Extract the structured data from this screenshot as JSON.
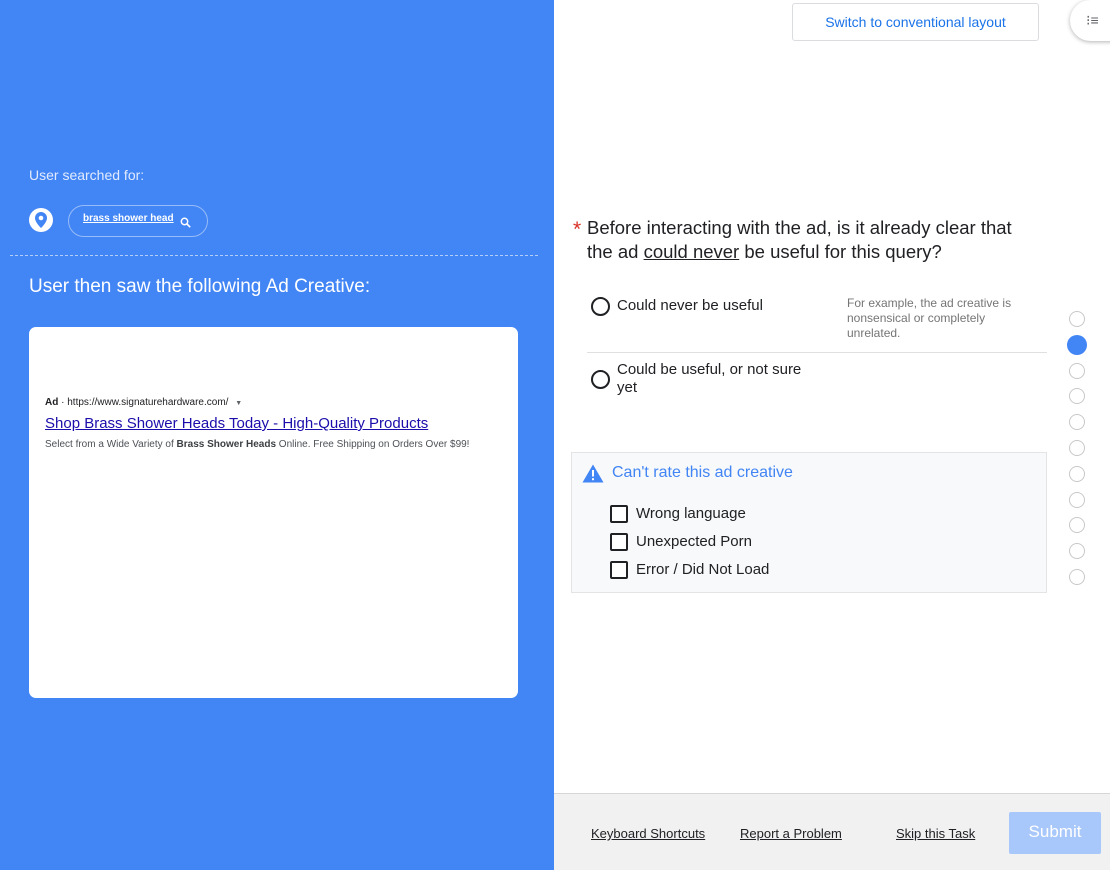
{
  "context": {
    "searched_label": "User searched for:",
    "query": "brass shower head",
    "saw_label": "User then saw the following Ad Creative:"
  },
  "ad": {
    "badge": "Ad",
    "separator": "·",
    "url": "https://www.signaturehardware.com/",
    "headline": "Shop Brass Shower Heads Today - High-Quality Products",
    "desc_before": "Select from a Wide Variety of ",
    "desc_bold": "Brass Shower Heads",
    "desc_after": " Online. Free Shipping on Orders Over $99!"
  },
  "header": {
    "switch_layout": "Switch to conventional layout",
    "menu_glyph": "⁝≡"
  },
  "question": {
    "required_mark": "*",
    "text_before": "Before interacting with the ad, is it already clear that the ad ",
    "text_underlined": "could never",
    "text_after": " be useful for this query?",
    "options": [
      {
        "label": "Could never be useful",
        "help": "For example, the ad creative is nonsensical or completely unrelated."
      },
      {
        "label": "Could be useful, or not sure yet"
      }
    ]
  },
  "cant_rate": {
    "title": "Can't rate this ad creative",
    "options": [
      "Wrong language",
      "Unexpected Porn",
      "Error / Did Not Load"
    ]
  },
  "progress": {
    "total_steps": 11,
    "current_step": 2
  },
  "footer": {
    "keyboard_shortcuts": "Keyboard Shortcuts",
    "report_problem": "Report a Problem",
    "skip_task": "Skip this Task",
    "submit": "Submit"
  },
  "colors": {
    "accent": "#4285f4",
    "required": "#d93025",
    "link": "#1a0dab",
    "submit_disabled": "#a8c7fa"
  }
}
